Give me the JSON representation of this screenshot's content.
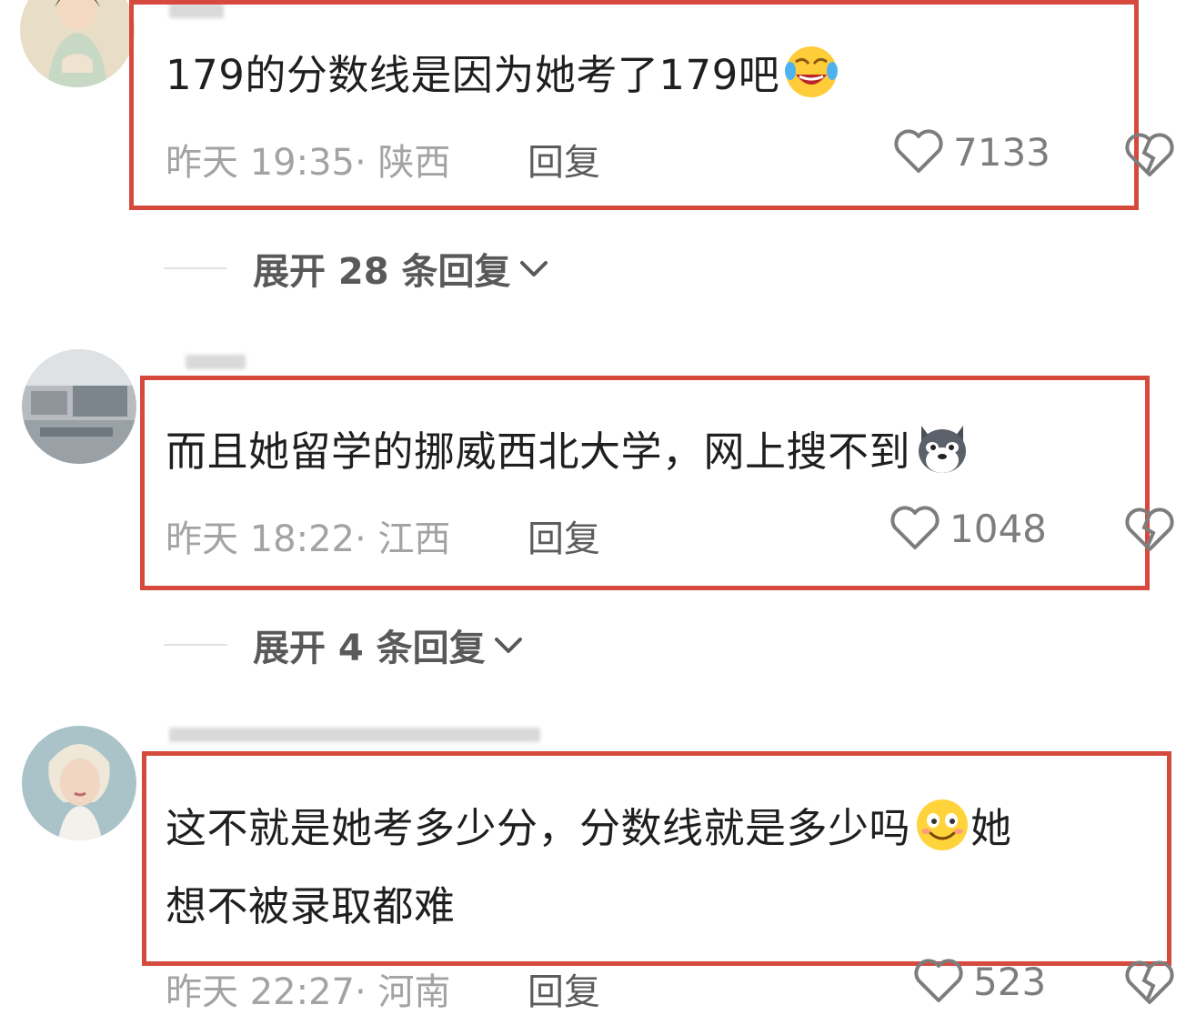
{
  "comments": [
    {
      "text_lines": [
        "179的分数线是因为她考了179吧"
      ],
      "emoji": "laughing-crying-emoji",
      "time": "昨天 19:35",
      "location": "陕西",
      "reply_label": "回复",
      "likes": "7133",
      "expand_label": "展开 28 条回复"
    },
    {
      "text_lines": [
        "而且她留学的挪威西北大学，网上搜不到"
      ],
      "emoji": "husky-dog-emoji",
      "time": "昨天 18:22",
      "location": "江西",
      "reply_label": "回复",
      "likes": "1048",
      "expand_label": "展开 4 条回复"
    },
    {
      "text_lines": [
        "这不就是她考多少分，分数线就是多少吗",
        "她",
        "想不被录取都难"
      ],
      "emoji": "smirk-smile-emoji",
      "time": "昨天 22:27",
      "location": "河南",
      "reply_label": "回复",
      "likes": "523"
    }
  ],
  "separator": "·",
  "colors": {
    "highlight_box": "#d64a3e",
    "meta_text": "#a3a3a3"
  },
  "icons": [
    "heart-outline-icon",
    "broken-heart-icon",
    "chevron-down-icon"
  ]
}
